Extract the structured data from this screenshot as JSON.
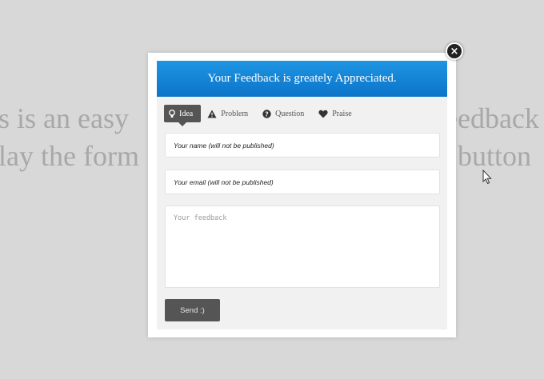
{
  "background": {
    "line1_left": "s is an easy",
    "line1_right": "eedback",
    "line2_left": "lay the form",
    "line2_right": "button"
  },
  "modal": {
    "title": "Your Feedback is greately Appreciated.",
    "close_icon": "close-icon",
    "tabs": [
      {
        "label": "Idea",
        "icon": "lightbulb-icon",
        "active": true
      },
      {
        "label": "Problem",
        "icon": "warning-icon",
        "active": false
      },
      {
        "label": "Question",
        "icon": "question-icon",
        "active": false
      },
      {
        "label": "Praise",
        "icon": "heart-icon",
        "active": false
      }
    ],
    "name_placeholder": "Your name (will not be published)",
    "email_placeholder": "Your email (will not be published)",
    "feedback_placeholder": "Your feedback",
    "send_label": "Send :)"
  },
  "colors": {
    "header": "#1582d8",
    "tab_active": "#555555",
    "send_button": "#555555",
    "page_background": "#d8d8d8"
  }
}
